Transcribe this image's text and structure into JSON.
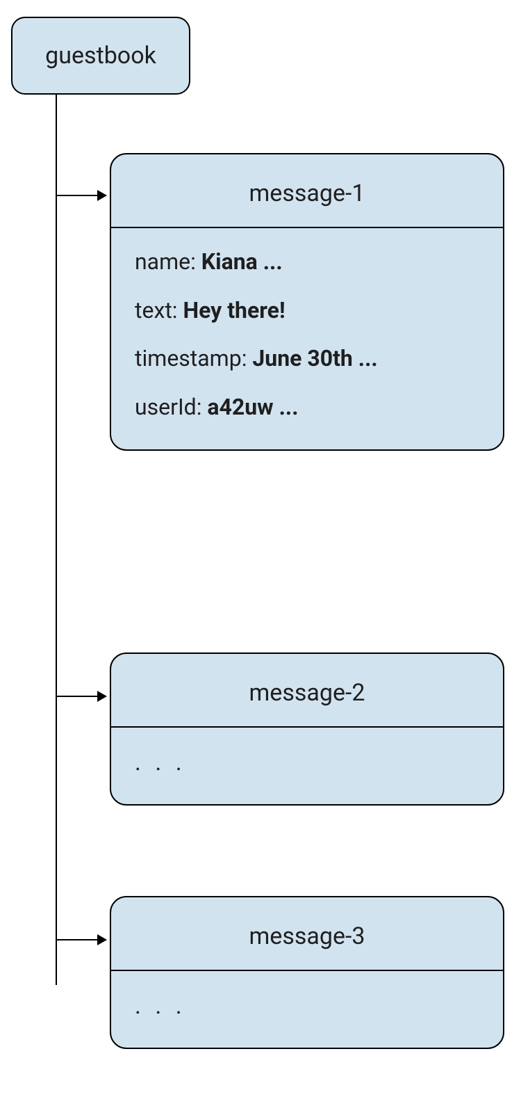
{
  "root": {
    "label": "guestbook"
  },
  "messages": [
    {
      "title": "message-1",
      "fields": [
        {
          "label": "name:",
          "value": "Kiana ..."
        },
        {
          "label": "text:",
          "value": "Hey there!"
        },
        {
          "label": "timestamp:",
          "value": "June 30th ..."
        },
        {
          "label": "userId:",
          "value": "a42uw ..."
        }
      ]
    },
    {
      "title": "message-2",
      "ellipsis": ". . ."
    },
    {
      "title": "message-3",
      "ellipsis": ". . ."
    }
  ]
}
